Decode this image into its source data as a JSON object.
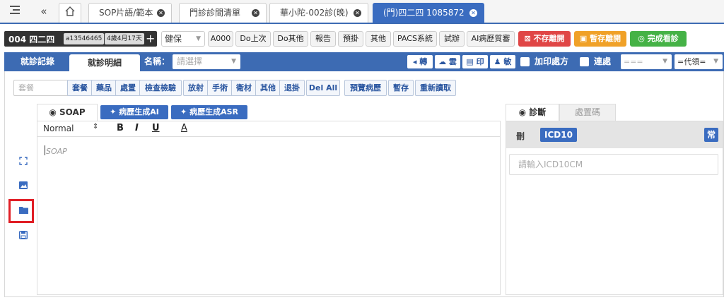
{
  "tabs": {
    "t1": "SOP片語/範本",
    "t2": "門診診間清單",
    "t3": "華小陀-002診(晚)",
    "t4": "(門)四二四 1085872"
  },
  "patient": {
    "name": "004 四二四",
    "id": "a13546465",
    "age": "4歲4月17天",
    "plus": "+"
  },
  "insurance": {
    "value": "健保"
  },
  "toolbar": {
    "a000": "A000",
    "do_last": "Do上次",
    "do_other": "Do其他",
    "report": "報告",
    "book": "預掛",
    "other": "其他",
    "pacs": "PACS系統",
    "trial": "試辦",
    "ai_review": "AI病歷質審",
    "no_save": "不存離開",
    "temp_save": "暫存離開",
    "complete": "完成看診"
  },
  "section": {
    "tab_record": "就診記錄",
    "tab_detail": "就診明細",
    "name_label": "名稱：",
    "name_placeholder": "請選擇",
    "transfer": "轉",
    "cloud": "雲",
    "print": "印",
    "allergy": "敏",
    "add_print": "加印處方",
    "continuous": "連處",
    "dd1": "===",
    "dd2": "=代領="
  },
  "content_toolbar": {
    "search": "套餐",
    "b1": "套餐",
    "b2": "藥品",
    "b3": "處置",
    "b4": "檢查檢驗",
    "b5": "放射",
    "b6": "手術",
    "b7": "衛材",
    "b8": "其他",
    "b9": "退掛",
    "b10": "Del All",
    "b11": "預覽病歷",
    "b12": "暫存",
    "b13": "重新讀取"
  },
  "editor": {
    "soap_tab": "SOAP",
    "ai_gen": "病歷生成AI",
    "ai_asr": "病歷生成ASR",
    "style": "Normal",
    "bold": "B",
    "italic": "I",
    "underline": "U",
    "color": "A",
    "placeholder": "SOAP"
  },
  "diagnosis": {
    "tab_diag": "診斷",
    "tab_proc": "處置碼",
    "delete": "刪",
    "icd": "ICD10",
    "frequent": "常",
    "input_placeholder": "請輸入ICD10CM"
  },
  "colors": {
    "primary": "#3d6bb3",
    "red": "#e04646",
    "orange": "#f0a128",
    "green": "#45b246",
    "highlight": "#e01e25"
  }
}
